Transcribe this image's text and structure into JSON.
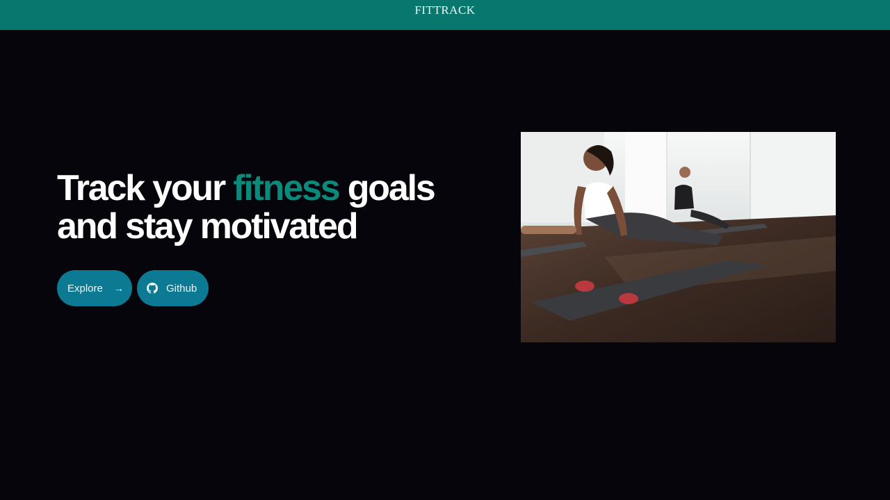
{
  "header": {
    "brand": "FITTRACK"
  },
  "hero": {
    "title_part1": "Track your ",
    "title_accent": "fitness",
    "title_part2": " goals and stay motivated",
    "accent_color": "#0b8a7c"
  },
  "actions": {
    "explore_label": "Explore",
    "explore_icon": "arrow-right-icon",
    "github_label": "Github",
    "github_icon": "github-icon"
  },
  "colors": {
    "topbar": "#08776d",
    "background": "#05050b",
    "button": "#0c7a92"
  }
}
